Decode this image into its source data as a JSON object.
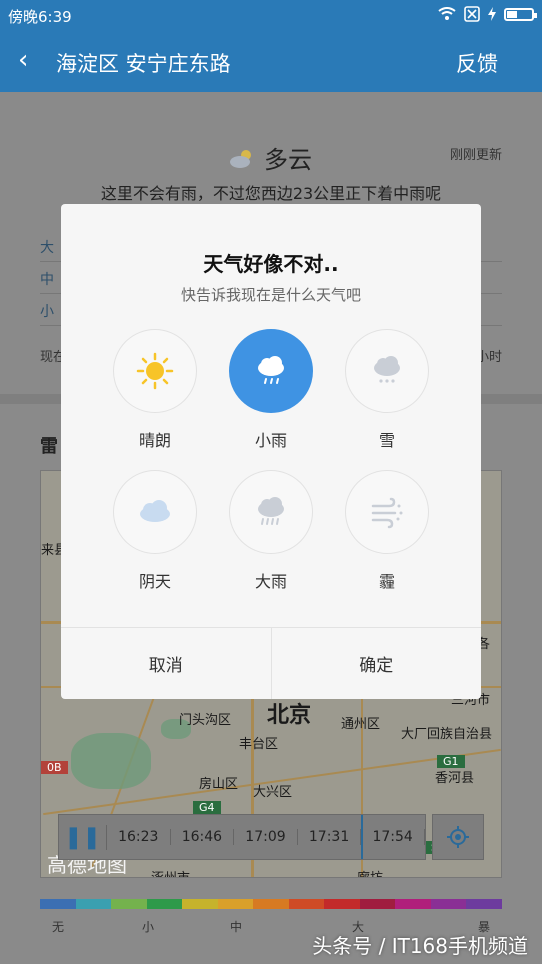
{
  "status": {
    "time": "傍晚6:39"
  },
  "appbar": {
    "back": "‹",
    "title": "海淀区 安宁庄东路",
    "feedback": "反馈"
  },
  "weather": {
    "condition": "多云",
    "updated": "刚刚更新",
    "rain_note": "这里不会有雨，不过您西边23公里正下着中雨呢",
    "rows": [
      "大",
      "中",
      "小"
    ],
    "now_label": "现在",
    "now_right": "小时"
  },
  "radar": {
    "title": "雷",
    "timeline": {
      "times": [
        "16:23",
        "16:46",
        "17:09",
        "17:31",
        "17:54"
      ]
    },
    "legend": {
      "labels": [
        "无",
        "小",
        "中",
        "大",
        "暴"
      ],
      "colors": [
        "#3b6fb3",
        "#3aa0b0",
        "#74b24d",
        "#2e9a4a",
        "#c6b32c",
        "#d9a02a",
        "#d77a22",
        "#cf4b26",
        "#c32a2a",
        "#a01d3f",
        "#b01e7b",
        "#8a2f95",
        "#6d3b9e"
      ]
    },
    "map_labels": {
      "beijing": "北京",
      "mentougou": "门头沟区",
      "fengtai": "丰台区",
      "tongzhou": "通州区",
      "fangshan": "房山区",
      "daxing": "大兴区",
      "dachang": "大厂回族自治县",
      "xianghe": "香河县",
      "zhuozhou": "涿州市",
      "sanhe": "三河市",
      "langfang": "廊坊",
      "laishui": "来县",
      "gaode": "高德地图",
      "g1": "G1",
      "g4": "G4",
      "b0b": "0B",
      "fragment_ge": "各",
      "fragment_s": "S"
    }
  },
  "dialog": {
    "title": "天气好像不对..",
    "subtitle": "快告诉我现在是什么天气吧",
    "options": [
      {
        "label": "晴朗",
        "icon": "sun-icon"
      },
      {
        "label": "小雨",
        "icon": "light-rain-icon"
      },
      {
        "label": "雪",
        "icon": "snow-icon"
      },
      {
        "label": "阴天",
        "icon": "cloud-icon"
      },
      {
        "label": "大雨",
        "icon": "heavy-rain-icon"
      },
      {
        "label": "霾",
        "icon": "haze-icon"
      }
    ],
    "selected": "小雨",
    "cancel": "取消",
    "confirm": "确定"
  },
  "watermark": "头条号 / IT168手机频道"
}
